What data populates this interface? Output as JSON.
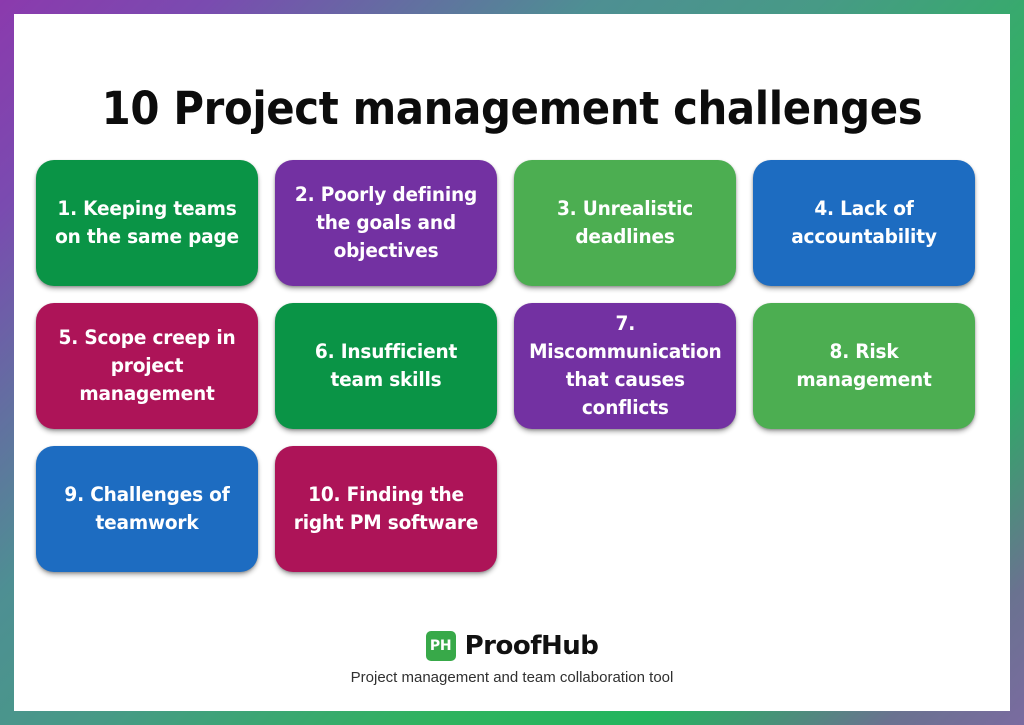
{
  "title": "10 Project management challenges",
  "palette": {
    "green_dark": "#0a9446",
    "green_light": "#4cae51",
    "purple": "#7331a2",
    "blue": "#1d6cc1",
    "crimson": "#ad1458",
    "white": "#ffffff",
    "title_color": "#0c0c0c",
    "border_gradient_start": "#8b3aad",
    "border_gradient_mid": "#479a86",
    "border_gradient_end": "#22b55e",
    "border_gradient_corner": "#6a7290"
  },
  "cards": [
    {
      "number": "1.",
      "text": "1. Keeping teams on the same page",
      "color": "#0a9446"
    },
    {
      "number": "2.",
      "text": "2. Poorly defining the goals and objectives",
      "color": "#7331a2"
    },
    {
      "number": "3.",
      "text": "3. Unrealistic deadlines",
      "color": "#4cae51"
    },
    {
      "number": "4.",
      "text": "4. Lack of accountability",
      "color": "#1d6cc1"
    },
    {
      "number": "5.",
      "text": "5. Scope creep in project management",
      "color": "#ad1458"
    },
    {
      "number": "6.",
      "text": "6. Insufficient team skills",
      "color": "#0a9446"
    },
    {
      "number": "7.",
      "text": "7. Miscommunication that causes conflicts",
      "color": "#7331a2"
    },
    {
      "number": "8.",
      "text": "8. Risk management",
      "color": "#4cae51"
    },
    {
      "number": "9.",
      "text": "9. Challenges of teamwork",
      "color": "#1d6cc1"
    },
    {
      "number": "10.",
      "text": "10. Finding the right PM software",
      "color": "#ad1458"
    }
  ],
  "footer": {
    "logo_mark_text": "PH",
    "brand_name": "ProofHub",
    "tagline": "Project management and team collaboration tool",
    "logo_mark_color": "#38a949"
  }
}
